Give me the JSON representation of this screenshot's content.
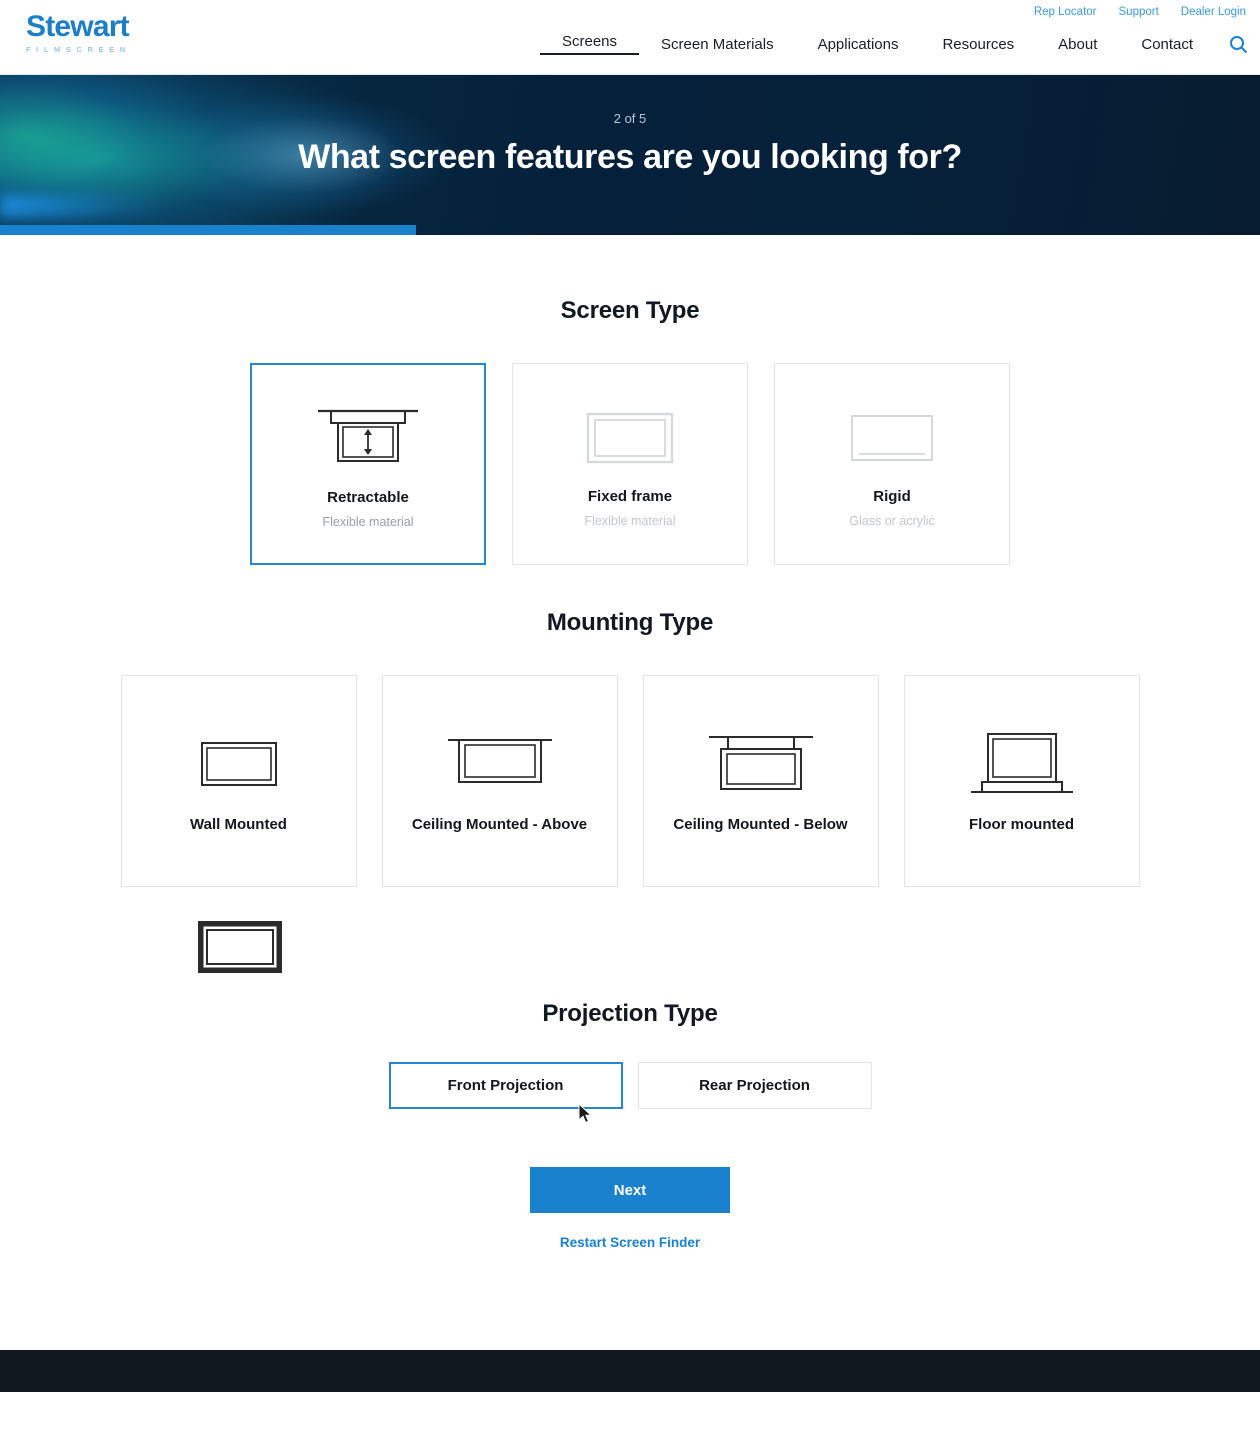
{
  "header": {
    "logo": {
      "word": "Stewart",
      "sub": "FILMSCREEN"
    },
    "utility_nav": [
      {
        "label": "Rep Locator"
      },
      {
        "label": "Support"
      },
      {
        "label": "Dealer Login"
      }
    ],
    "main_nav": [
      {
        "label": "Screens",
        "active": true
      },
      {
        "label": "Screen Materials",
        "active": false
      },
      {
        "label": "Applications",
        "active": false
      },
      {
        "label": "Resources",
        "active": false
      },
      {
        "label": "About",
        "active": false
      },
      {
        "label": "Contact",
        "active": false
      }
    ],
    "search_icon": "search-icon"
  },
  "hero": {
    "step": "2 of 5",
    "title": "What screen features are you looking for?",
    "progress_percent": 33,
    "background_color": "#06213a",
    "progress_color": "#1a82cd"
  },
  "screen_type": {
    "title": "Screen Type",
    "options": [
      {
        "label": "Retractable",
        "sub": "Flexible material",
        "selected": true,
        "icon": "retractable-screen-icon"
      },
      {
        "label": "Fixed frame",
        "sub": "Flexible material",
        "selected": false,
        "icon": "fixed-frame-screen-icon"
      },
      {
        "label": "Rigid",
        "sub": "Glass or acrylic",
        "selected": false,
        "icon": "rigid-screen-icon"
      }
    ]
  },
  "mounting_type": {
    "title": "Mounting Type",
    "options": [
      {
        "label": "Wall Mounted",
        "selected": false,
        "icon": "wall-mounted-icon"
      },
      {
        "label": "Ceiling Mounted - Above",
        "selected": false,
        "icon": "ceiling-above-icon"
      },
      {
        "label": "Ceiling Mounted - Below",
        "selected": false,
        "icon": "ceiling-below-icon"
      },
      {
        "label": "Floor mounted",
        "selected": false,
        "icon": "floor-mounted-icon"
      }
    ],
    "orphan_icon": "framed-screen-icon"
  },
  "projection_type": {
    "title": "Projection Type",
    "options": [
      {
        "label": "Front Projection",
        "selected": true
      },
      {
        "label": "Rear Projection",
        "selected": false
      }
    ]
  },
  "actions": {
    "next_label": "Next",
    "restart_label": "Restart Screen Finder",
    "accent_color": "#1a82cd"
  }
}
